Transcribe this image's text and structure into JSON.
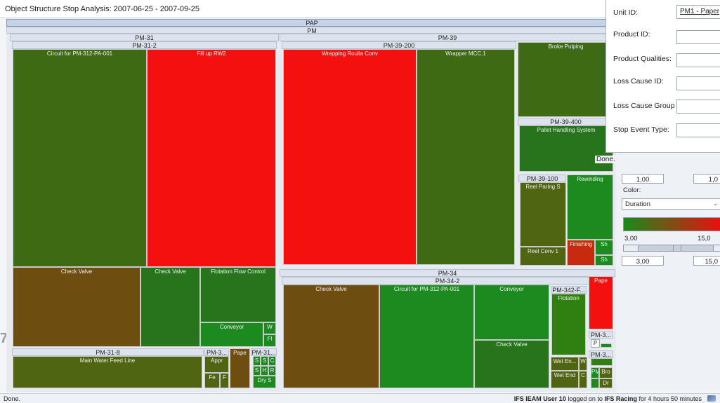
{
  "window_title": "Object Structure Stop Analysis:  2007-06-25 - 2007-09-25",
  "edge_fragment": "7",
  "treemap": {
    "root": "PAP",
    "level1": "PM",
    "pm31": {
      "label": "PM-31",
      "sub": "PM-31-2",
      "cells": {
        "circuit": "Circuit for PM-312-PA-001",
        "fillup": "Fill up RW2",
        "check_valve_a": "Check Valve",
        "check_valve_b": "Check Valve",
        "flotation": "Flotation Flow Control",
        "conveyor": "Conveyor",
        "w": "W",
        "fl": "Fl"
      },
      "pm318": {
        "label": "PM-31-8",
        "main": "Main Water Feed Line"
      },
      "pm3a": {
        "label": "PM-3...",
        "appr": "Appr",
        "fe": "Fe",
        "f": "F"
      },
      "pape": "Pape",
      "pm31b": {
        "label": "PM-31...",
        "s1": "S",
        "s2": "S",
        "c": "C",
        "s3": "S",
        "h": "H",
        "r": "R",
        "dry": "Dry S"
      }
    },
    "pm39": {
      "label": "PM-39",
      "pm39200": {
        "label": "PM-39-200",
        "wrap": "Wrapping Roulia Conv",
        "mcc": "Wrapper MCC.1"
      },
      "broke": "Broke Pulping",
      "pm39400": {
        "label": "PM-39-400",
        "pallet": "Pallet Handling System"
      },
      "pm39100": {
        "label": "PM-39-100",
        "reel": "Reel Paring S",
        "conv": "Reel Conv 1"
      },
      "rewinding": "Rewinding",
      "finishing": "Finishing",
      "sh1": "Sh",
      "sh2": "Sh"
    },
    "pm34": {
      "label": "PM-34",
      "sub": "PM-34-2",
      "check_valve": "Check Valve",
      "circuit": "Circuit for PM-312-PA-001",
      "conveyor": "Conveyor",
      "check_valve2": "Check Valve",
      "pm342f": "PM-342-F...",
      "flotation": "Flotation",
      "wet1": "Wet En...",
      "w": "W",
      "wet2": "Wet End",
      "c": "C",
      "pape": "Pape",
      "pm3a": "PM-3...",
      "p": "P",
      "pm3b": "PM-3...",
      "pm": "PM",
      "bro": "Bro",
      "dr": "Dr"
    }
  },
  "popup": {
    "unit_id_label": "Unit ID:",
    "unit_id_value": "PM1 - Paper",
    "product_id_label": "Product ID:",
    "product_id_value": "",
    "product_qualities_label": "Product Qualities:",
    "product_qualities_value": "",
    "loss_cause_id_label": "Loss Cause ID:",
    "loss_cause_id_value": "",
    "loss_cause_group_label": "Loss Cause Group",
    "loss_cause_group_value": "",
    "stop_event_type_label": "Stop Event Type:",
    "stop_event_type_value": "",
    "done": "Done."
  },
  "side_panel": {
    "size_min": "1,00",
    "size_max": "1,0",
    "color_label": "Color:",
    "color_select": "Duration",
    "gradient_start": "#1a8a1a",
    "gradient_end": "#e81010",
    "color_min": "3,00",
    "color_max": "15,0",
    "range_min": "3,00",
    "range_max": "15,0"
  },
  "status": {
    "left": "Done.",
    "user": "IFS IEAM User 10",
    "logged": "logged on to",
    "system": "IFS Racing",
    "duration": "for 4 hours 50 minutes"
  }
}
